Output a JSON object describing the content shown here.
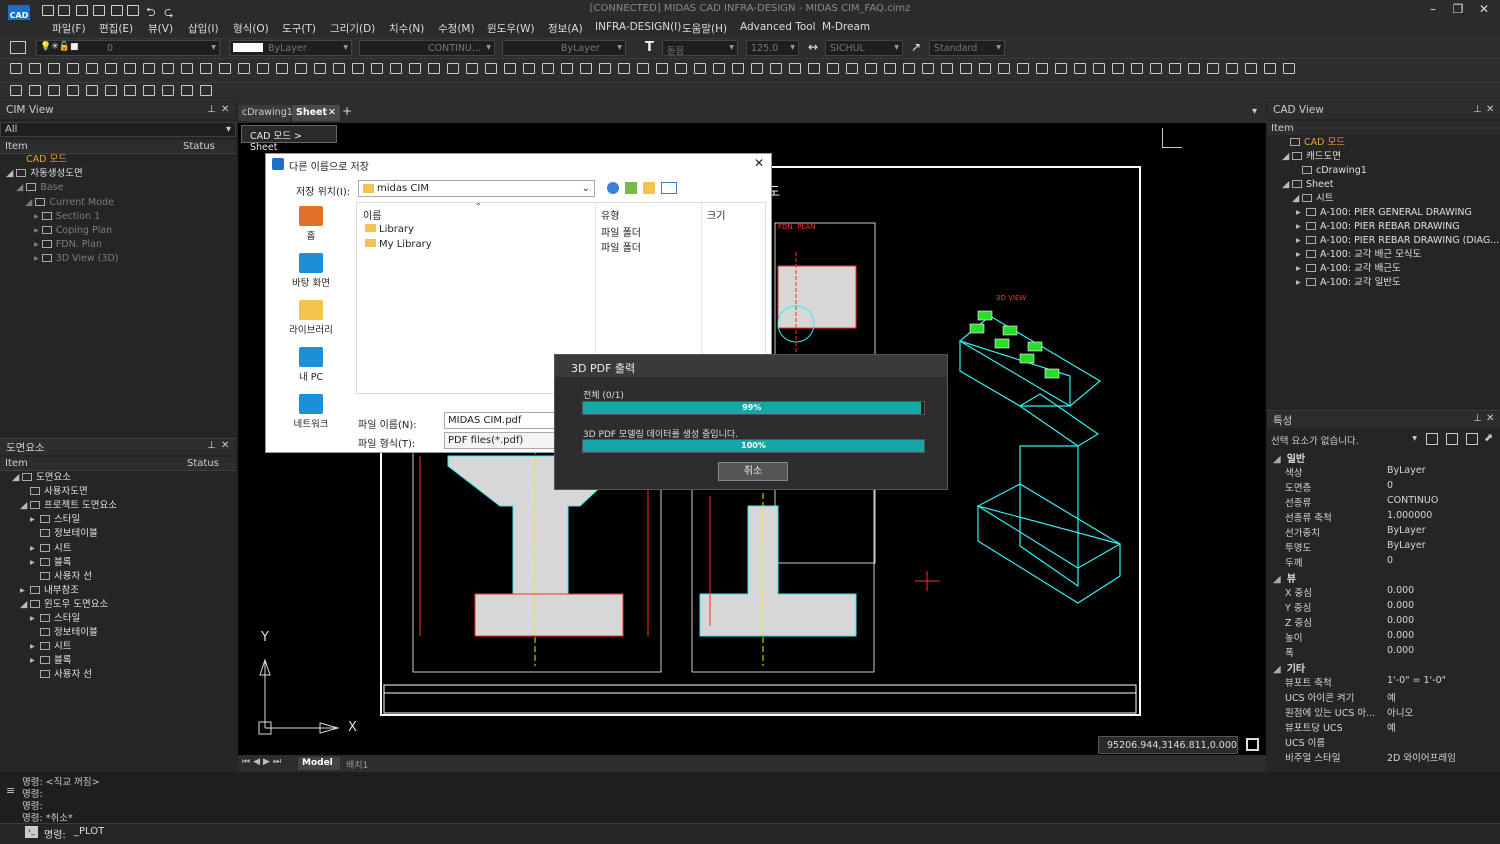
{
  "window": {
    "title": "[CONNECTED] MIDAS CAD INFRA-DESIGN - MIDAS CIM_FAQ.cimz",
    "logo": "CAD"
  },
  "menu": [
    "파일(F)",
    "편집(E)",
    "뷰(V)",
    "삽입(I)",
    "형식(O)",
    "도구(T)",
    "그리기(D)",
    "치수(N)",
    "수정(M)",
    "윈도우(W)",
    "정보(A)",
    "INFRA-DESIGN(I)",
    "도움말(H)",
    "Advanced Tool",
    "M-Dream"
  ],
  "toolbar": {
    "layer_value": "0",
    "color_value": "ByLayer",
    "linetype_value": "CONTINU...",
    "lineweight_value": "ByLayer",
    "text_style": "돋음",
    "text_height": "125.0",
    "dim_style": "SICHUL",
    "multileader_style": "Standard"
  },
  "cim_view": {
    "title": "CIM View",
    "filter": "All",
    "col_item": "Item",
    "col_status": "Status",
    "items": [
      "CAD 모드",
      "자동생성도면",
      "Base",
      "Current Mode",
      "Section 1",
      "Coping Plan",
      "FDN. Plan",
      "3D View (3D)"
    ]
  },
  "drawing_elements": {
    "title": "도면요소",
    "col_item": "Item",
    "col_status": "Status",
    "items": [
      "도면요소",
      "사용자도면",
      "프로젝트 도면요소",
      "스타일",
      "정보테이블",
      "시트",
      "블록",
      "사용자 선",
      "내부참조",
      "윈도우 도면요소",
      "스타일",
      "정보테이블",
      "시트",
      "블록",
      "사용자 선"
    ]
  },
  "tabs": {
    "drawing_tab": "cDrawing1",
    "sheet_tab": "Sheet",
    "breadcrumb": "CAD 모드 > Sheet",
    "add": "+"
  },
  "cad_view": {
    "title": "CAD View",
    "col_item": "Item",
    "items": [
      "CAD 모드",
      "캐드도면",
      "cDrawing1",
      "Sheet",
      "시트",
      "A-100: PIER GENERAL DRAWING",
      "A-100: PIER REBAR DRAWING",
      "A-100: PIER REBAR DRAWING (DIAG...",
      "A-100: 교각 배근 모식도",
      "A-100: 교각 배근도",
      "A-100: 교각 일반도"
    ]
  },
  "properties": {
    "title": "특성",
    "selection": "선택 요소가 없습니다.",
    "section_general": "일반",
    "section_view": "뷰",
    "section_misc": "기타",
    "rows": [
      {
        "k": "색상",
        "v": "ByLayer"
      },
      {
        "k": "도면층",
        "v": "0"
      },
      {
        "k": "선종류",
        "v": "CONTINUO"
      },
      {
        "k": "선종류 축척",
        "v": "1.000000"
      },
      {
        "k": "선가중치",
        "v": "ByLayer"
      },
      {
        "k": "투명도",
        "v": "ByLayer"
      },
      {
        "k": "두께",
        "v": "0"
      }
    ],
    "view_rows": [
      {
        "k": "X 중심",
        "v": "0.000"
      },
      {
        "k": "Y 중심",
        "v": "0.000"
      },
      {
        "k": "Z 중심",
        "v": "0.000"
      },
      {
        "k": "높이",
        "v": "0.000"
      },
      {
        "k": "폭",
        "v": "0.000"
      }
    ],
    "misc_rows": [
      {
        "k": "뷰포트 축척",
        "v": "1'-0\" = 1'-0\""
      },
      {
        "k": "UCS 아이콘 켜기",
        "v": "예"
      },
      {
        "k": "원점에 있는 UCS 아...",
        "v": "아니오"
      },
      {
        "k": "뷰포트당 UCS",
        "v": "예"
      },
      {
        "k": "UCS 이름",
        "v": ""
      },
      {
        "k": "비주얼 스타일",
        "v": "2D 와이어프레임"
      }
    ]
  },
  "save_dialog": {
    "title": "다른 이름으로 저장",
    "location_label": "저장 위치(I):",
    "location": "midas CIM",
    "places": [
      "홈",
      "바탕 화면",
      "라이브러리",
      "내 PC",
      "네트워크"
    ],
    "col_name": "이름",
    "col_type": "유형",
    "col_size": "크기",
    "files": [
      {
        "name": "Library",
        "type": "파일 폴더"
      },
      {
        "name": "My Library",
        "type": "파일 폴더"
      }
    ],
    "filename_label": "파일 이름(N):",
    "filename": "MIDAS CIM.pdf",
    "filetype_label": "파일 형식(T):",
    "filetype": "PDF files(*.pdf)"
  },
  "pdf_progress": {
    "title": "3D PDF 출력",
    "total_label": "전체 (0/1)",
    "total_percent": "99%",
    "total_value": 0.99,
    "step_label": "3D PDF 모델링 데이터를 생성 중입니다.",
    "step_percent": "100%",
    "step_value": 1.0,
    "cancel": "취소"
  },
  "drawing": {
    "heading": "도",
    "fdn_plan": "FDN. PLAN",
    "view3d": "3D VIEW"
  },
  "layout_tabs": {
    "model": "Model",
    "layout": "배치1"
  },
  "coords": "95206.944,3146.811,0.000",
  "ucs": {
    "x": "X",
    "y": "Y"
  },
  "command": {
    "history": [
      "명령: <직교 꺼짐>",
      "명령:",
      "명령:",
      "명령: *취소*"
    ],
    "prompt": "명령:",
    "current": "_PLOT"
  }
}
